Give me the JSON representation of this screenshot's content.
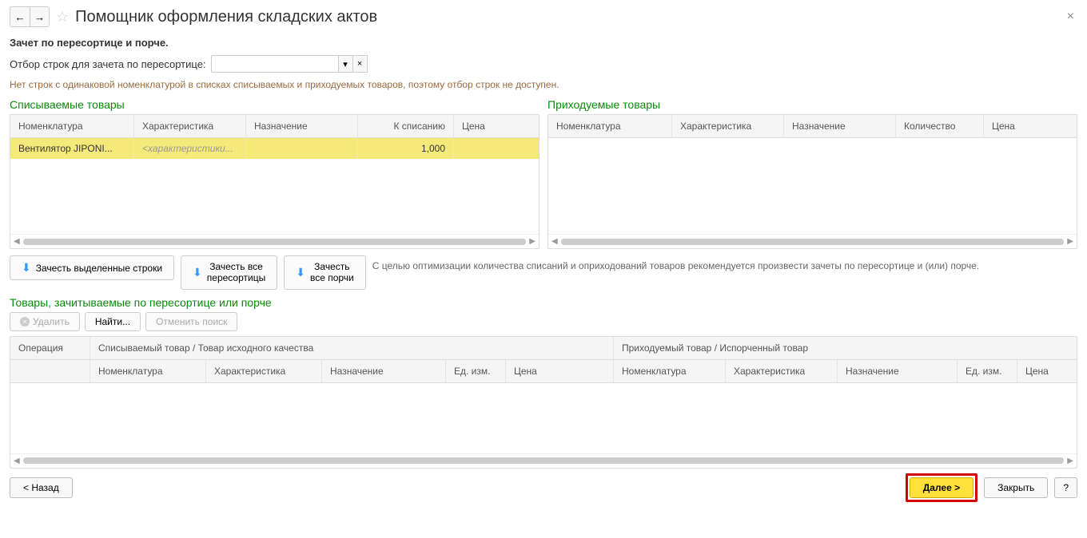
{
  "header": {
    "title": "Помощник оформления складских актов"
  },
  "section_title": "Зачет по пересортице и порче.",
  "filter": {
    "label": "Отбор строк для зачета по пересортице:",
    "dropdown_symbol": "▾",
    "clear_symbol": "×"
  },
  "warning": "Нет строк с одинаковой номенклатурой в списках списываемых и приходуемых товаров, поэтому отбор строк не доступен.",
  "left_panel": {
    "title": "Списываемые товары",
    "columns": {
      "c1": "Номенклатура",
      "c2": "Характеристика",
      "c3": "Назначение",
      "c4": "К списанию",
      "c5": "Цена"
    },
    "row": {
      "nom": "Вентилятор JIPONI...",
      "char": "<характеристики...",
      "assign": "",
      "qty": "1,000",
      "price": ""
    }
  },
  "right_panel": {
    "title": "Приходуемые товары",
    "columns": {
      "c1": "Номенклатура",
      "c2": "Характеристика",
      "c3": "Назначение",
      "c4": "Количество",
      "c5": "Цена"
    }
  },
  "actions": {
    "btn1": "Зачесть выделенные строки",
    "btn2_l1": "Зачесть все",
    "btn2_l2": "пересортицы",
    "btn3_l1": "Зачесть",
    "btn3_l2": "все порчи",
    "hint": "С целью оптимизации количества списаний и оприходований товаров рекомендуется произвести зачеты по пересортице и (или) порче."
  },
  "bottom_section": {
    "title": "Товары, зачитываемые по пересортице или порче",
    "toolbar": {
      "delete": "Удалить",
      "find": "Найти...",
      "cancel": "Отменить поиск"
    },
    "header1": {
      "op": "Операция",
      "left": "Списываемый товар / Товар исходного качества",
      "right": "Приходуемый товар / Испорченный товар"
    },
    "header2": {
      "nom": "Номенклатура",
      "char": "Характеристика",
      "assign": "Назначение",
      "unit": "Ед. изм.",
      "price": "Цена",
      "nom2": "Номенклатура",
      "char2": "Характеристика",
      "assign2": "Назначение",
      "unit2": "Ед. изм.",
      "price2": "Цена"
    }
  },
  "footer": {
    "back": "< Назад",
    "next": "Далее >",
    "close": "Закрыть",
    "help": "?"
  }
}
